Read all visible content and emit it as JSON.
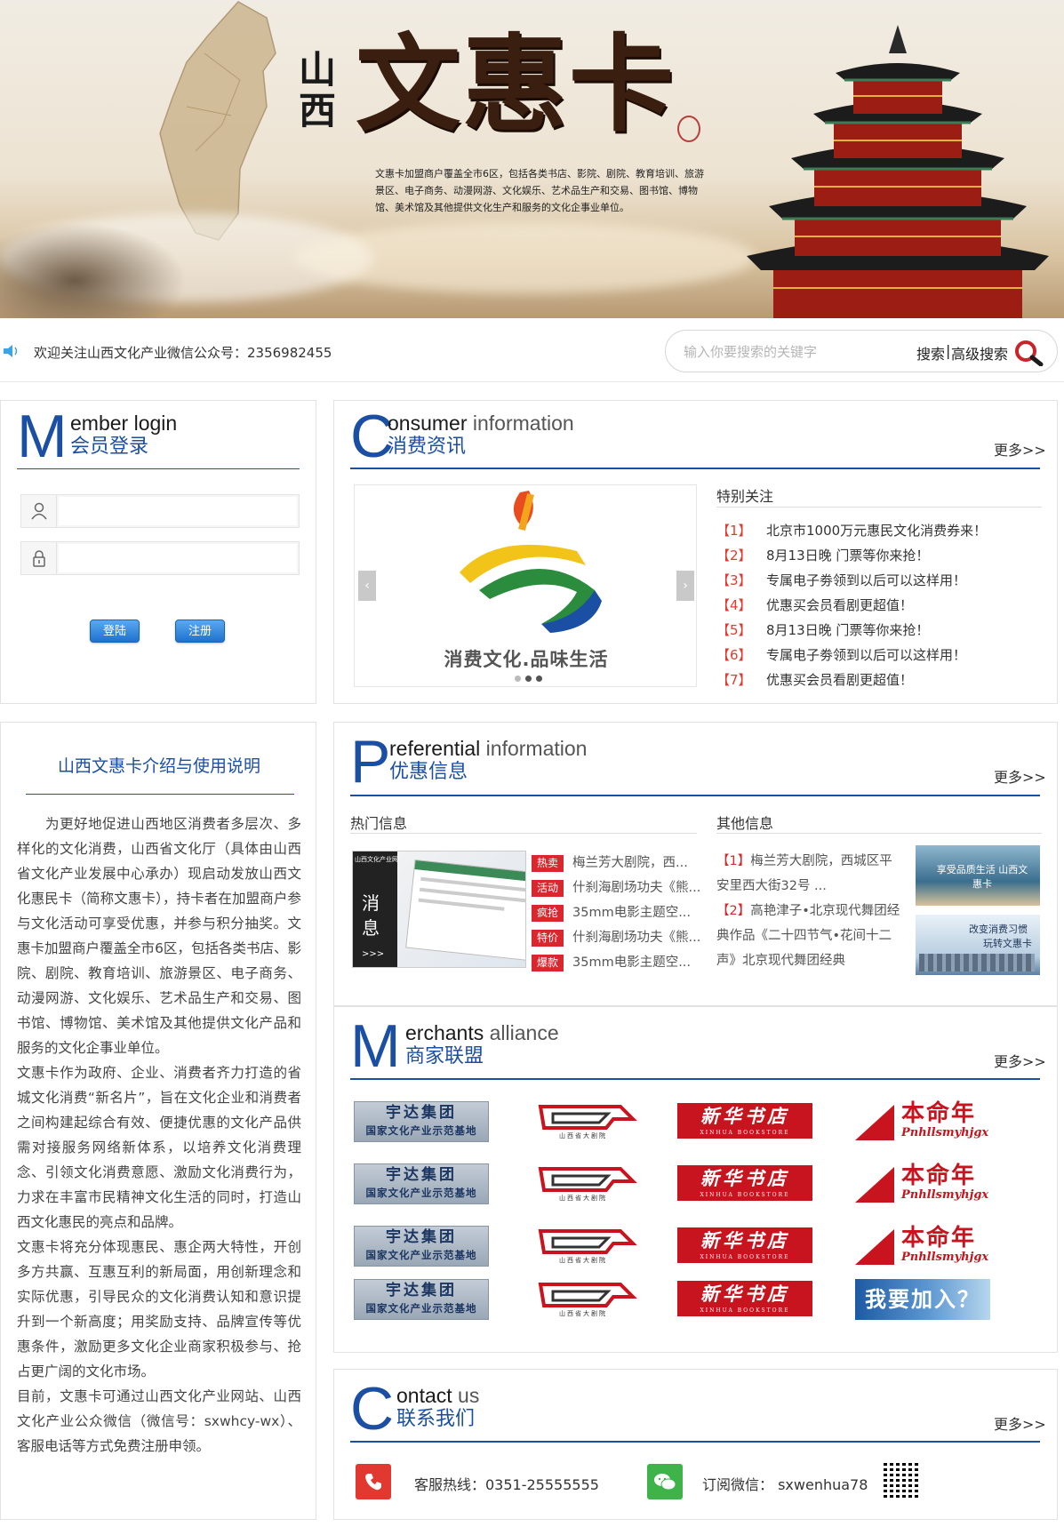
{
  "banner": {
    "brand_small": "山西",
    "brand_big": "文惠卡",
    "description": "文惠卡加盟商户覆盖全市6区，包括各类书店、影院、剧院、教育培训、旅游景区、电子商务、动漫网游、文化娱乐、艺术品生产和交易、图书馆、博物馆、美术馆及其他提供文化生产和服务的文化企事业单位。"
  },
  "notice": {
    "icon": "speaker-icon",
    "text": "欢迎关注山西文化产业微信公众号：2356982455"
  },
  "search": {
    "placeholder": "输入你要搜索的关键字",
    "search_label": "搜索",
    "separator": "|",
    "advanced_label": "高级搜索"
  },
  "login": {
    "big_letter": "M",
    "en_rest": "ember login",
    "cn_title": "会员登录",
    "login_button": "登陆",
    "register_button": "注册"
  },
  "consumer": {
    "big_letter": "C",
    "en_first": "onsumer",
    "en_rest": " information",
    "cn_title": "消费资讯",
    "more": "更多>>",
    "slide_caption": "消费文化.品味生活",
    "special_title": "特别关注",
    "items": [
      {
        "num": "【1】",
        "text": "北京市1000万元惠民文化消费券来！"
      },
      {
        "num": "【2】",
        "text": "8月13日晚 门票等你来抢！"
      },
      {
        "num": "【3】",
        "text": "专属电子劵领到以后可以这样用！"
      },
      {
        "num": "【4】",
        "text": "优惠买会员看剧更超值！"
      },
      {
        "num": "【5】",
        "text": "8月13日晚 门票等你来抢！"
      },
      {
        "num": "【6】",
        "text": "专属电子劵领到以后可以这样用！"
      },
      {
        "num": "【7】",
        "text": "优惠买会员看剧更超值！"
      }
    ]
  },
  "intro": {
    "title": "山西文惠卡介绍与使用说明",
    "paragraphs": [
      "　　为更好地促进山西地区消费者多层次、多样化的文化消费，山西省文化厅（具体由山西省文化产业发展中心承办）现启动发放山西文化惠民卡（简称文惠卡），持卡者在加盟商户参与文化活动可享受优惠，并参与积分抽奖。文惠卡加盟商户覆盖全市6区，包括各类书店、影院、剧院、教育培训、旅游景区、电子商务、动漫网游、文化娱乐、艺术品生产和交易、图书馆、博物馆、美术馆及其他提供文化产品和服务的文化企事业单位。",
      "文惠卡作为政府、企业、消费者齐力打造的省城文化消费“新名片”，旨在文化企业和消费者之间构建起综合有效、便捷优惠的文化产品供需对接服务网络新体系，以培养文化消费理念、引领文化消费意愿、激励文化消费行为，力求在丰富市民精神文化生活的同时，打造山西文化惠民的亮点和品牌。",
      "文惠卡将充分体现惠民、惠企两大特性，开创多方共赢、互惠互利的新局面，用创新理念和实际优惠，引导民众的文化消费认知和意识提升到一个新高度；用奖励支持、品牌宣传等优惠条件，激励更多文化企业商家积极参与、抢占更广阔的文化市场。",
      "目前，文惠卡可通过山西文化产业网站、山西文化产业公众微信（微信号：sxwhcy-wx）、客服电话等方式免费注册申领。"
    ]
  },
  "preferential": {
    "big_letter": "P",
    "en_first": "referential",
    "en_rest": " information",
    "cn_title": "优惠信息",
    "more": "更多>>",
    "hot_title": "热门信息",
    "other_title": "其他信息",
    "thumb_text": "消息",
    "thumb_arrows": ">>>",
    "thumb_site": "山西文化产业网",
    "hot_items": [
      {
        "tag": "热卖",
        "text": "梅兰芳大剧院，西..."
      },
      {
        "tag": "活动",
        "text": "什刹海剧场功夫《熊..."
      },
      {
        "tag": "疯抢",
        "text": "35mm电影主题空..."
      },
      {
        "tag": "特价",
        "text": "什刹海剧场功夫《熊..."
      },
      {
        "tag": "爆款",
        "text": "35mm电影主题空..."
      }
    ],
    "other_items": [
      {
        "num": "【1】",
        "text": "梅兰芳大剧院，西城区平安里西大街32号 ..."
      },
      {
        "num": "【2】",
        "text": "高艳津子•北京现代舞团经典作品《二十四节气•花间十二声》北京现代舞团经典"
      }
    ],
    "side_img1": "享受品质生活 山西文惠卡",
    "side_img2_a": "改变消费习惯",
    "side_img2_b": "玩转文惠卡"
  },
  "merchants": {
    "big_letter": "M",
    "en_first": "erchants",
    "en_rest": " alliance",
    "cn_title": "商家联盟",
    "more": "更多>>",
    "yuda_a": "宇达集团",
    "yuda_b": "国家文化产业示范基地",
    "theatre": "山西省大剧院",
    "xinhua_a": "新华书店",
    "xinhua_b": "XINHUA BOOKSTORE",
    "bmn_a": "本命年",
    "bmn_b": "Pnhllsmyhjgx",
    "join": "我要加入？"
  },
  "contact": {
    "big_letter": "C",
    "en_first": "ontact",
    "en_rest": " us",
    "cn_title": "联系我们",
    "more": "更多>>",
    "hotline": "客服热线：0351-25555555",
    "wechat": "订阅微信： sxwenhua78"
  },
  "colors": {
    "accent": "#1b4fa3",
    "red": "#d9272e"
  }
}
